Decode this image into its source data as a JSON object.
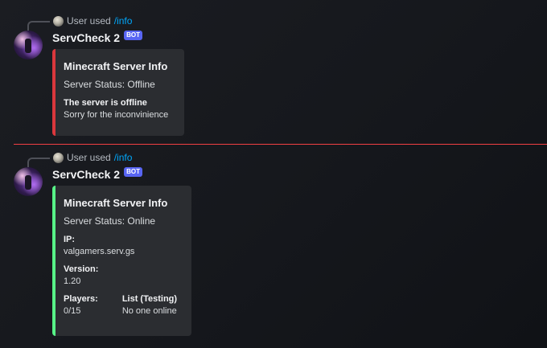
{
  "messages": [
    {
      "reply": {
        "prefix": "User used",
        "command": "/info"
      },
      "author": {
        "name": "ServCheck 2",
        "tag": "BOT"
      },
      "embed": {
        "accent": "#da373c",
        "title": "Minecraft Server Info",
        "description": "Server Status: Offline",
        "fields": [
          {
            "name": "The server is offline",
            "value": "Sorry for the inconvinience"
          }
        ]
      }
    },
    {
      "reply": {
        "prefix": "User used",
        "command": "/info"
      },
      "author": {
        "name": "ServCheck 2",
        "tag": "BOT"
      },
      "embed": {
        "accent": "#57f287",
        "title": "Minecraft Server Info",
        "description": "Server Status: Online",
        "fields": [
          {
            "name": "IP:",
            "value": "valgamers.serv.gs"
          },
          {
            "name": "Version:",
            "value": "1.20"
          },
          {
            "name": "Players:",
            "value": "0/15"
          },
          {
            "name": "List (Testing)",
            "value": "No one online"
          }
        ]
      }
    }
  ],
  "divider": {
    "color": "#f23f43"
  },
  "icons": {
    "avatar": "bot-avatar",
    "reply_avatar": "user-avatar"
  }
}
